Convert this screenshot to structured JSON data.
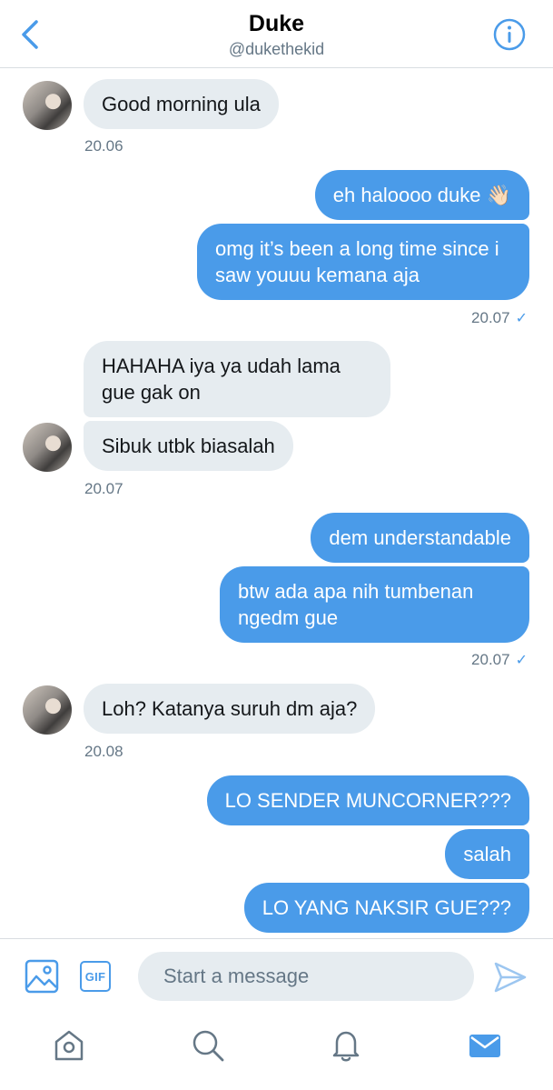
{
  "header": {
    "title": "Duke",
    "handle": "@dukethekid",
    "back_icon": "chevron-left-icon",
    "info_icon": "info-icon"
  },
  "messages": [
    {
      "side": "in",
      "text": "Good morning ula"
    },
    {
      "side": "in",
      "time": "20.06"
    },
    {
      "side": "out",
      "text": "eh haloooo duke 👋🏻"
    },
    {
      "side": "out",
      "text": "omg it’s been a long time since i saw youuu kemana aja"
    },
    {
      "side": "out",
      "time": "20.07",
      "status": "✓"
    },
    {
      "side": "in",
      "text": "HAHAHA iya ya udah lama gue gak on"
    },
    {
      "side": "in",
      "text": "Sibuk utbk biasalah"
    },
    {
      "side": "in",
      "time": "20.07"
    },
    {
      "side": "out",
      "text": "dem understandable"
    },
    {
      "side": "out",
      "text": "btw ada apa nih tumbenan ngedm gue"
    },
    {
      "side": "out",
      "time": "20.07",
      "status": "✓"
    },
    {
      "side": "in",
      "text": "Loh? Katanya suruh dm aja?"
    },
    {
      "side": "in",
      "time": "20.08"
    },
    {
      "side": "out",
      "text": "LO SENDER MUNCORNER???"
    },
    {
      "side": "out",
      "text": "salah"
    },
    {
      "side": "out",
      "text": "LO YANG NAKSIR GUE???"
    }
  ],
  "composer": {
    "placeholder": "Start a message",
    "gif_label": "GIF",
    "media_icon": "image-icon",
    "send_icon": "send-icon"
  },
  "tabs": [
    "home-icon",
    "search-icon",
    "notifications-icon",
    "messages-icon"
  ],
  "colors": {
    "accent": "#4a9be9",
    "incoming_bubble": "#e6ecf0",
    "muted_text": "#657786",
    "divider": "#d9dde1"
  }
}
